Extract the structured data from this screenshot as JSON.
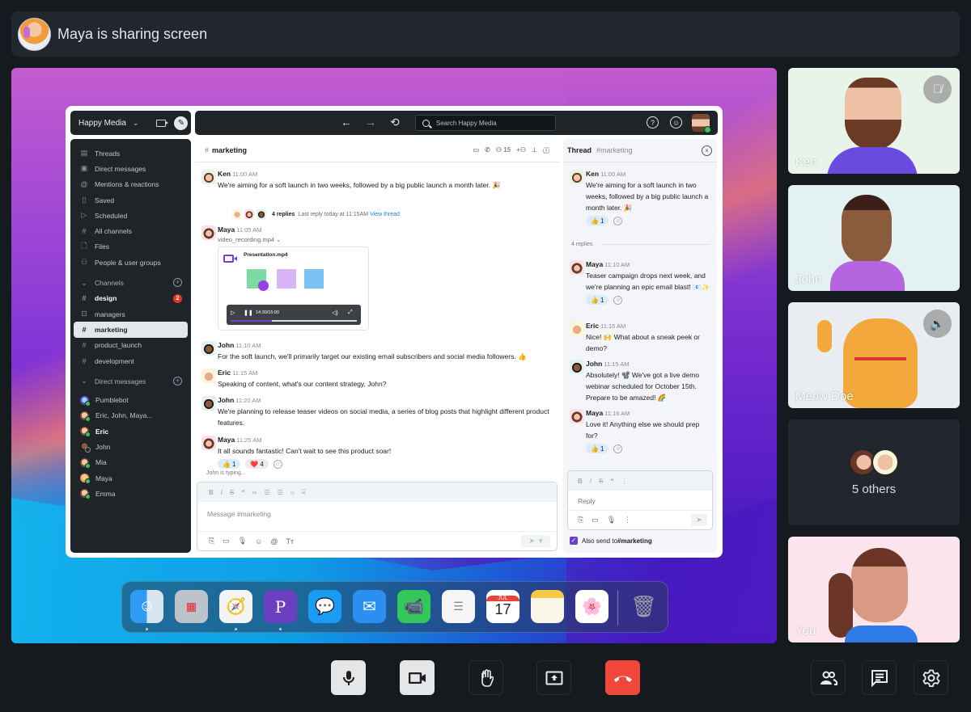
{
  "banner": {
    "title": "Maya is sharing screen",
    "presenter": "Maya"
  },
  "app": {
    "workspace": "Happy Media",
    "search_placeholder": "Search Happy Media",
    "sidebar": {
      "nav": [
        {
          "label": "Threads",
          "icon": "threads-icon"
        },
        {
          "label": "Direct messages",
          "icon": "direct-messages-icon"
        },
        {
          "label": "Mentions & reactions",
          "icon": "at-icon"
        },
        {
          "label": "Saved",
          "icon": "bookmark-icon"
        },
        {
          "label": "Scheduled",
          "icon": "scheduled-icon"
        },
        {
          "label": "All channels",
          "icon": "channel-search-icon"
        },
        {
          "label": "Files",
          "icon": "file-icon"
        },
        {
          "label": "People & user groups",
          "icon": "people-icon"
        }
      ],
      "channels_label": "Channels",
      "channels": [
        {
          "name": "design",
          "badge": "2",
          "bold": true,
          "icon": "#"
        },
        {
          "name": "managers",
          "icon": "lock"
        },
        {
          "name": "marketing",
          "active": true,
          "icon": "#"
        },
        {
          "name": "product_launch",
          "icon": "#"
        },
        {
          "name": "development",
          "icon": "#"
        }
      ],
      "dms_label": "Direct messages",
      "dms": [
        {
          "name": "Pumblebot",
          "status": "online"
        },
        {
          "name": "Eric, John, Maya...",
          "status": "online"
        },
        {
          "name": "Eric",
          "status": "online",
          "bold": true
        },
        {
          "name": "John",
          "status": "offline"
        },
        {
          "name": "Mia",
          "status": "online"
        },
        {
          "name": "Maya",
          "status": "online"
        },
        {
          "name": "Emma",
          "status": "online"
        }
      ]
    },
    "channel": {
      "name": "marketing",
      "member_count": "15",
      "messages": [
        {
          "author": "Ken",
          "time": "11:00 AM",
          "text": "We're aiming for a soft launch in two weeks, followed by a big public launch a month later. 🎉"
        },
        {
          "author": "Maya",
          "time": "11:05 AM",
          "file_label": "video_recording.mp4",
          "file_name": "Presentation.mp4",
          "player_time": "14:30/15:00",
          "progress": 0.33
        },
        {
          "author": "John",
          "time": "11:10 AM",
          "text": "For the soft launch, we'll primarily target our existing email subscribers and social media followers. 👍"
        },
        {
          "author": "Eric",
          "time": "11:15 AM",
          "text": "Speaking of content, what's our content strategy, John?"
        },
        {
          "author": "John",
          "time": "11:20 AM",
          "text": "We're planning to release teaser videos on social media, a series of blog posts that highlight different product features."
        },
        {
          "author": "Maya",
          "time": "11:25 AM",
          "text": "It all sounds fantastic! Can't wait to see this product soar!",
          "reactions": [
            {
              "emoji": "👍",
              "count": "1"
            },
            {
              "emoji": "❤️",
              "count": "4"
            }
          ]
        }
      ],
      "thread_summary": {
        "replies": "4 replies",
        "last_reply": "Last reply today at 11:15AM",
        "link": "View thread"
      },
      "typing": "John is typing...",
      "composer_placeholder": "Message #marketing"
    },
    "thread": {
      "title": "Thread",
      "channel": "#marketing",
      "parent": {
        "author": "Ken",
        "time": "11:00 AM",
        "text": "We're aiming for a soft launch in two weeks, followed by a big public launch a month later. 🎉",
        "reaction": {
          "emoji": "👍",
          "count": "1"
        }
      },
      "replies_label": "4 replies",
      "replies": [
        {
          "author": "Maya",
          "time": "11:10 AM",
          "text": "Teaser campaign drops next week, and we're planning an epic email blast! 📧✨",
          "reaction": {
            "emoji": "👍",
            "count": "1"
          }
        },
        {
          "author": "Eric",
          "time": "11:15 AM",
          "text": "Nice! 🙌 What about a sneak peek or demo?"
        },
        {
          "author": "John",
          "time": "11:15 AM",
          "text": "Absolutely! 📽️ We've got a live demo webinar scheduled for October 15th. Prepare to be amazed! 🌈"
        },
        {
          "author": "Maya",
          "time": "11:16 AM",
          "text": "Love it! Anything else we should prep for?",
          "reaction": {
            "emoji": "👍",
            "count": "1"
          }
        }
      ],
      "reply_placeholder": "Reply",
      "also_send_prefix": "Also send to ",
      "also_send_channel": "#marketing",
      "also_send_checked": true
    }
  },
  "dock": {
    "apps": [
      "Finder",
      "Launchpad",
      "Safari",
      "Pumble",
      "Messages",
      "Mail",
      "FaceTime",
      "Reminders",
      "Calendar",
      "Notes",
      "Photos",
      "Trash"
    ],
    "calendar_month": "JUL",
    "calendar_day": "17"
  },
  "participants": [
    {
      "name": "Ken",
      "status_icon": "muted-mic-icon",
      "bg": "#e8f4e9"
    },
    {
      "name": "John",
      "bg": "#e3f1f2"
    },
    {
      "name": "Meow Doe",
      "status_icon": "speaker-icon",
      "bg": "#e9ecf0"
    },
    {
      "others_label": "5 others"
    },
    {
      "name": "You",
      "bg": "#fbe4ec"
    }
  ],
  "controls": [
    "Microphone",
    "Camera",
    "Raise hand",
    "Share screen",
    "Leave call",
    "Participants",
    "Chat",
    "Settings"
  ],
  "colors": {
    "accent": "#7b3fd6",
    "leave": "#f0473a",
    "link": "#1c84d6",
    "badge": "#e5372c"
  }
}
